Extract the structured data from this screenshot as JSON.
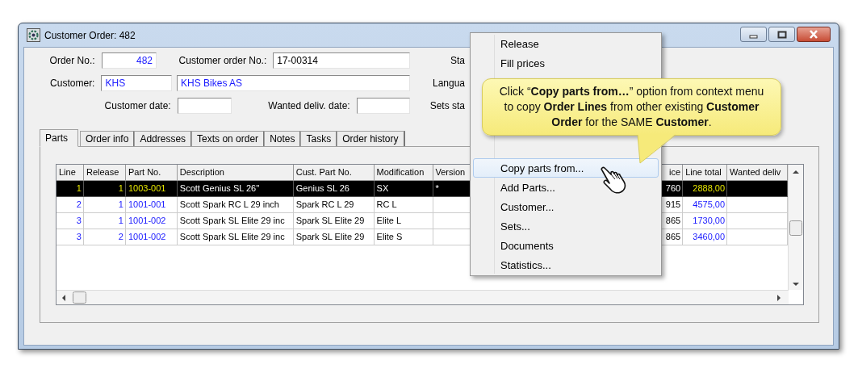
{
  "window": {
    "title": "Customer Order: 482"
  },
  "form": {
    "order_no": {
      "label": "Order No.:",
      "value": "482"
    },
    "customer_order_no": {
      "label": "Customer order No.:",
      "value": "17-00314"
    },
    "customer": {
      "label": "Customer:",
      "code": "KHS",
      "name": "KHS Bikes AS"
    },
    "customer_date": {
      "label": "Customer date:"
    },
    "wanted_deliv_date": {
      "label": "Wanted deliv. date:"
    },
    "side_labels": [
      "Sta",
      "Langua",
      "Sets sta"
    ]
  },
  "tabs": [
    {
      "label": "Parts",
      "selected": true
    },
    {
      "label": "Order info",
      "selected": false
    },
    {
      "label": "Addresses",
      "selected": false
    },
    {
      "label": "Texts on order",
      "selected": false
    },
    {
      "label": "Notes",
      "selected": false
    },
    {
      "label": "Tasks",
      "selected": false
    },
    {
      "label": "Order history",
      "selected": false
    }
  ],
  "table": {
    "columns": [
      {
        "label": "Line",
        "kind": "number"
      },
      {
        "label": "Release",
        "kind": "number"
      },
      {
        "label": "Part No.",
        "kind": "id"
      },
      {
        "label": "Description",
        "kind": "text"
      },
      {
        "label": "Cust. Part No.",
        "kind": "text"
      },
      {
        "label": "Modification",
        "kind": "text"
      },
      {
        "label": "Version",
        "kind": "text"
      },
      {
        "label": "ice",
        "kind": "figure"
      },
      {
        "label": "Line total",
        "kind": "number"
      },
      {
        "label": "Wanted deliv",
        "kind": "text"
      }
    ],
    "rows": [
      {
        "selected": true,
        "cells": [
          "1",
          "1",
          "1003-001",
          "Scott Genius SL 26''",
          "Genius SL 26",
          "SX",
          "*",
          "760",
          "2888,00",
          null
        ]
      },
      {
        "selected": false,
        "cells": [
          "2",
          "1",
          "1001-001",
          "Scott Spark RC L 29 inch",
          "Spark RC L 29",
          "RC L",
          null,
          "915",
          "4575,00",
          null
        ]
      },
      {
        "selected": false,
        "cells": [
          "3",
          "1",
          "1001-002",
          "Scott Spark SL Elite 29 inc",
          "Spark SL Elite 29",
          "Elite L",
          null,
          "865",
          "1730,00",
          null
        ]
      },
      {
        "selected": false,
        "cells": [
          "3",
          "2",
          "1001-002",
          "Scott Spark SL Elite 29 inc",
          "Spark SL Elite 29",
          "Elite S",
          null,
          "865",
          "3460,00",
          null
        ]
      }
    ]
  },
  "context_menu": {
    "groups": [
      {
        "items": [
          {
            "label": "Release",
            "selected": false
          },
          {
            "label": "Fill prices",
            "selected": false
          }
        ]
      },
      {
        "items": [
          {
            "label": "Copy parts from...",
            "selected": true
          },
          {
            "label": "Add Parts...",
            "selected": false
          },
          {
            "label": "Customer...",
            "selected": false
          },
          {
            "label": "Sets...",
            "selected": false
          },
          {
            "label": "Documents",
            "selected": false
          },
          {
            "label": "Statistics...",
            "selected": false
          }
        ]
      }
    ]
  },
  "callout": {
    "text": "Click “**Copy parts from…**” option from context menu to copy **Order Lines** from other existing **Customer Order** for the SAME **Customer**."
  }
}
